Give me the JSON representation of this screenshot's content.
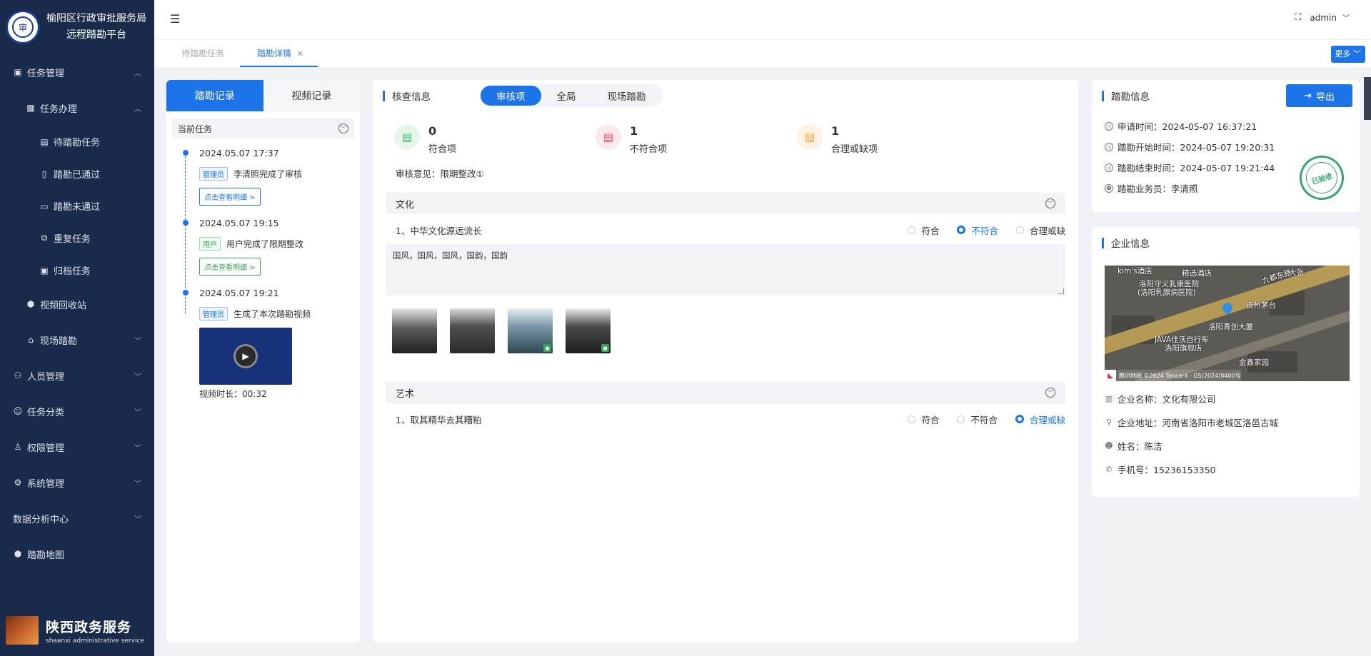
{
  "sidebar": {
    "brand_line1": "榆阳区行政审批服务局",
    "brand_line2": "远程踏勘平台",
    "logo_mark": "审",
    "menu": [
      {
        "label": "任务管理",
        "icon": "task-icon",
        "expanded": true
      },
      {
        "label": "任务办理",
        "icon": "calendar-icon",
        "expanded": true
      },
      {
        "label": "待踏勘任务",
        "icon": "list-icon"
      },
      {
        "label": "踏勘已通过",
        "icon": "doc-check-icon"
      },
      {
        "label": "踏勘未通过",
        "icon": "doc-x-icon"
      },
      {
        "label": "重复任务",
        "icon": "repeat-icon"
      },
      {
        "label": "归档任务",
        "icon": "archive-icon"
      },
      {
        "label": "视频回收站",
        "icon": "recycle-icon"
      },
      {
        "label": "现场踏勘",
        "icon": "site-icon",
        "expanded": false
      },
      {
        "label": "人员管理",
        "icon": "people-icon",
        "expanded": false
      },
      {
        "label": "任务分类",
        "icon": "category-icon",
        "expanded": false
      },
      {
        "label": "权限管理",
        "icon": "permission-icon",
        "expanded": false
      },
      {
        "label": "系统管理",
        "icon": "gear-icon",
        "expanded": false
      },
      {
        "label": "数据分析中心",
        "expanded": false
      },
      {
        "label": "踏勘地图",
        "icon": "map-icon"
      }
    ],
    "footer_title": "陕西政务服务",
    "footer_sub": "shaanxi administrative service"
  },
  "header": {
    "user": "admin"
  },
  "tabs": {
    "tab1": "待踏勘任务",
    "tab2": "踏勘详情",
    "more": "更多"
  },
  "left_panel": {
    "tab_active": "踏勘记录",
    "tab_other": "视频记录",
    "current_task": "当前任务",
    "timeline": [
      {
        "time": "2024.05.07 17:37",
        "role": "管理员",
        "text": "李清照完成了审核",
        "link": "点击查看明细 >"
      },
      {
        "time": "2024.05.07 19:15",
        "role": "用户",
        "text": "用户完成了限期整改",
        "link": "点击查看明细 >"
      },
      {
        "time": "2024.05.07 19:21",
        "role": "管理员",
        "text": "生成了本次踏勘视频"
      }
    ],
    "video_duration": "视频时长：00:32"
  },
  "main": {
    "section_title": "核查信息",
    "segments": [
      "审核项",
      "全局",
      "现场踏勘"
    ],
    "active_segment": "审核项",
    "stats": [
      {
        "num": "0",
        "label": "符合项",
        "color": "#33b36b",
        "bg": "#e6f6ec"
      },
      {
        "num": "1",
        "label": "不符合项",
        "color": "#e8475e",
        "bg": "#fde9ec"
      },
      {
        "num": "1",
        "label": "合理或缺项",
        "color": "#f2a031",
        "bg": "#fef3e3"
      }
    ],
    "opinion": "审核意见：限期整改①",
    "groups": [
      {
        "title": "文化",
        "question": "1、中华文化源远流长",
        "options": [
          "符合",
          "不符合",
          "合理或缺"
        ],
        "selected": "不符合",
        "comment": "国风，国风，国风，国韵，国韵"
      },
      {
        "title": "艺术",
        "question": "1、取其精华去其糟粕",
        "options": [
          "符合",
          "不符合",
          "合理或缺"
        ],
        "selected": "合理或缺"
      }
    ]
  },
  "survey_info": {
    "title": "踏勘信息",
    "export": "导出",
    "apply_time": "申请时间：2024-05-07 16:37:21",
    "start_time": "踏勘开始时间：2024-05-07 19:20:31",
    "end_time": "踏勘结束时间：2024-05-07 19:21:44",
    "staff": "踏勘业务员：李清照",
    "stamp": "已验收"
  },
  "enterprise": {
    "title": "企业信息",
    "map_labels": [
      "洛阳守义乳康医院",
      "(洛阳乳腺病医院)",
      "精选酒店",
      "贵州茅台",
      "洛阳青创大厦",
      "JAVA佳沃自行车",
      "洛阳旗舰店",
      "金鑫家园",
      "九都东路",
      "大张",
      "kim's酒店"
    ],
    "map_attribution": "腾讯地图 ©2024 Tencent - GS(2024)0400号",
    "name": "企业名称：文化有限公司",
    "address": "企业地址：河南省洛阳市老城区洛邑古城",
    "person": "姓名：陈洁",
    "phone": "手机号：15236153350"
  }
}
